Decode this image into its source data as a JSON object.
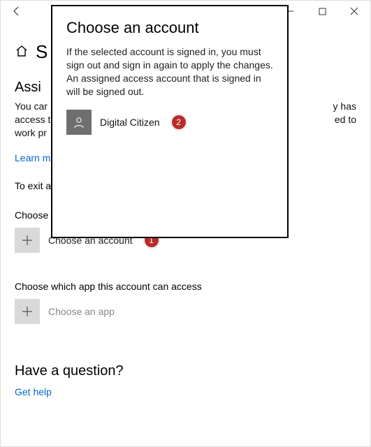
{
  "titlebar": {
    "back_icon": "back-arrow",
    "min_icon": "minimize",
    "max_icon": "maximize",
    "close_icon": "close"
  },
  "header": {
    "title_partial": "S",
    "home_icon": "home"
  },
  "section": {
    "heading_partial": "Assi",
    "desc_line1": "You car",
    "desc_line2_suffix_a": "y has",
    "desc_line3": "access t",
    "desc_line3_suffix": "ed to",
    "desc_line4": "work pr",
    "learn_more_partial": "Learn m",
    "exit_partial": "To exit a",
    "choose_label_partial": "Choose"
  },
  "accountTile": {
    "label": "Choose an account",
    "badge": "1"
  },
  "appSection": {
    "prompt": "Choose which app this account can access",
    "label": "Choose an app"
  },
  "question": {
    "heading": "Have a question?",
    "link": "Get help"
  },
  "modal": {
    "title": "Choose an account",
    "desc": "If the selected account is signed in, you must sign out and sign in again to apply the changes. An assigned access account that is signed in will be signed out.",
    "account_name": "Digital Citizen",
    "badge": "2"
  }
}
